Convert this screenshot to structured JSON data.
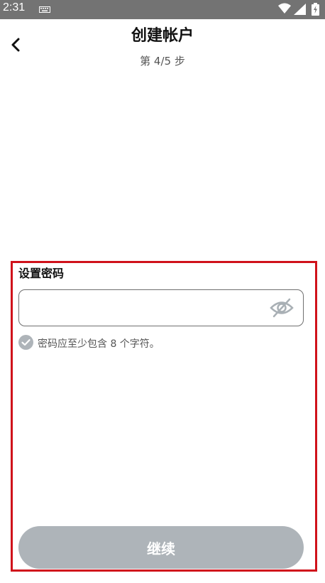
{
  "status_bar": {
    "time": "2:31",
    "icons": [
      "keyboard-icon",
      "wifi-icon",
      "signal-icon",
      "battery-icon"
    ]
  },
  "header": {
    "back_icon": "chevron-left-icon",
    "title": "创建帐户",
    "step": "第 4/5 步"
  },
  "form": {
    "label": "设置密码",
    "password_value": "",
    "password_placeholder": "",
    "visibility_icon": "eye-off-icon",
    "hint": "密码应至少包含 8 个字符。",
    "hint_icon": "check-circle-icon",
    "highlight_color": "#d0121b"
  },
  "footer": {
    "continue_label": "继续",
    "continue_color": "#aeb4b9"
  }
}
